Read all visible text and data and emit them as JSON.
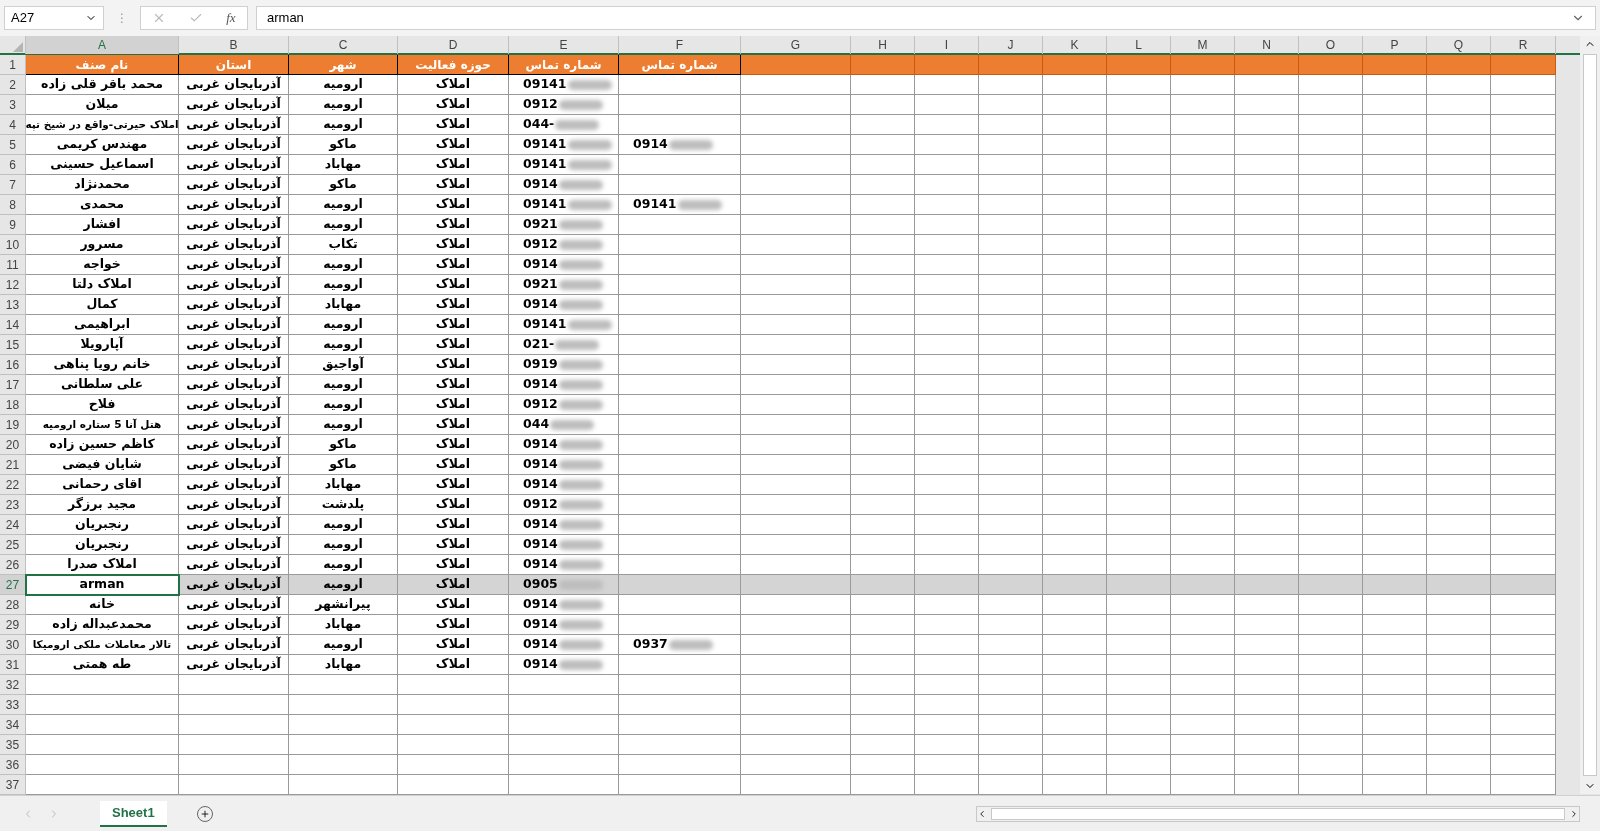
{
  "formula_bar": {
    "name_box": "A27",
    "separator": "⋮",
    "function_label": "fx",
    "value": "arman"
  },
  "columns": {
    "col_a": {
      "label": "A",
      "selected": true
    },
    "col_b": {
      "label": "B",
      "selected": false
    },
    "col_c": {
      "label": "C",
      "selected": false
    },
    "col_d": {
      "label": "D",
      "selected": false
    },
    "col_e": {
      "label": "E",
      "selected": false
    },
    "col_f": {
      "label": "F",
      "selected": false
    },
    "col_g": {
      "label": "G",
      "selected": false
    },
    "col_h": {
      "label": "H",
      "selected": false
    },
    "col_i": {
      "label": "I",
      "selected": false
    },
    "col_j": {
      "label": "J",
      "selected": false
    },
    "col_k": {
      "label": "K",
      "selected": false
    },
    "col_l": {
      "label": "L",
      "selected": false
    },
    "col_m": {
      "label": "M",
      "selected": false
    },
    "col_n": {
      "label": "N",
      "selected": false
    },
    "col_o": {
      "label": "O",
      "selected": false
    },
    "col_p": {
      "label": "P",
      "selected": false
    },
    "col_q": {
      "label": "Q",
      "selected": false
    },
    "col_r": {
      "label": "R",
      "selected": false
    }
  },
  "header_row": {
    "number": "1",
    "cells": {
      "col_a": "نام صنف",
      "col_b": "استان",
      "col_c": "شهر",
      "col_d": "حوزه فعالیت",
      "col_e": "شماره تماس",
      "col_f": "شماره تماس"
    }
  },
  "rows": [
    {
      "number": "2",
      "selected": false,
      "cells": {
        "col_a": "محمد باقر قلی زاده",
        "col_b": "آذربایجان غربی",
        "col_c": "ارومیه",
        "col_d": "املاک",
        "col_e": "09141"
      }
    },
    {
      "number": "3",
      "selected": false,
      "cells": {
        "col_a": "میلان",
        "col_b": "آذربایجان غربی",
        "col_c": "ارومیه",
        "col_d": "املاک",
        "col_e": "0912"
      }
    },
    {
      "number": "4",
      "selected": false,
      "cells": {
        "col_a": "املاک حیرتی-واقع در شیخ تپه",
        "col_b": "آذربایجان غربی",
        "col_c": "ارومیه",
        "col_d": "املاک",
        "col_e": "044-"
      }
    },
    {
      "number": "5",
      "selected": false,
      "cells": {
        "col_a": "مهندس کریمی",
        "col_b": "آذربایجان غربی",
        "col_c": "ماکو",
        "col_d": "املاک",
        "col_e": "09141",
        "col_f": "0914"
      }
    },
    {
      "number": "6",
      "selected": false,
      "cells": {
        "col_a": "اسماعیل حسینی",
        "col_b": "آذربایجان غربی",
        "col_c": "مهاباد",
        "col_d": "املاک",
        "col_e": "09141"
      }
    },
    {
      "number": "7",
      "selected": false,
      "cells": {
        "col_a": "محمدنژاد",
        "col_b": "آذربایجان غربی",
        "col_c": "ماکو",
        "col_d": "املاک",
        "col_e": "0914"
      }
    },
    {
      "number": "8",
      "selected": false,
      "cells": {
        "col_a": "محمدی",
        "col_b": "آذربایجان غربی",
        "col_c": "ارومیه",
        "col_d": "املاک",
        "col_e": "09141",
        "col_f": "09141"
      }
    },
    {
      "number": "9",
      "selected": false,
      "cells": {
        "col_a": "افشار",
        "col_b": "آذربایجان غربی",
        "col_c": "ارومیه",
        "col_d": "املاک",
        "col_e": "0921"
      }
    },
    {
      "number": "10",
      "selected": false,
      "cells": {
        "col_a": "مسرور",
        "col_b": "آذربایجان غربی",
        "col_c": "تکاب",
        "col_d": "املاک",
        "col_e": "0912"
      }
    },
    {
      "number": "11",
      "selected": false,
      "cells": {
        "col_a": "خواجه",
        "col_b": "آذربایجان غربی",
        "col_c": "ارومیه",
        "col_d": "املاک",
        "col_e": "0914"
      }
    },
    {
      "number": "12",
      "selected": false,
      "cells": {
        "col_a": "املاک دلتا",
        "col_b": "آذربایجان غربی",
        "col_c": "ارومیه",
        "col_d": "املاک",
        "col_e": "0921"
      }
    },
    {
      "number": "13",
      "selected": false,
      "cells": {
        "col_a": "کمال",
        "col_b": "آذربایجان غربی",
        "col_c": "مهاباد",
        "col_d": "املاک",
        "col_e": "0914"
      }
    },
    {
      "number": "14",
      "selected": false,
      "cells": {
        "col_a": "ابراهیمی",
        "col_b": "آذربایجان غربی",
        "col_c": "ارومیه",
        "col_d": "املاک",
        "col_e": "09141"
      }
    },
    {
      "number": "15",
      "selected": false,
      "cells": {
        "col_a": "آپارویلا",
        "col_b": "آذربایجان غربی",
        "col_c": "ارومیه",
        "col_d": "املاک",
        "col_e": "021-"
      }
    },
    {
      "number": "16",
      "selected": false,
      "cells": {
        "col_a": "خانم رویا پناهی",
        "col_b": "آذربایجان غربی",
        "col_c": "آواجیق",
        "col_d": "املاک",
        "col_e": "0919"
      }
    },
    {
      "number": "17",
      "selected": false,
      "cells": {
        "col_a": "علی سلطانی",
        "col_b": "آذربایجان غربی",
        "col_c": "ارومیه",
        "col_d": "املاک",
        "col_e": "0914"
      }
    },
    {
      "number": "18",
      "selected": false,
      "cells": {
        "col_a": "فلاح",
        "col_b": "آذربایجان غربی",
        "col_c": "ارومیه",
        "col_d": "املاک",
        "col_e": "0912"
      }
    },
    {
      "number": "19",
      "selected": false,
      "cells": {
        "col_a": "هتل آنا 5 ستاره ارومیه",
        "col_b": "آذربایجان غربی",
        "col_c": "ارومیه",
        "col_d": "املاک",
        "col_e": "044"
      }
    },
    {
      "number": "20",
      "selected": false,
      "cells": {
        "col_a": "کاظم حسین زاده",
        "col_b": "آذربایجان غربی",
        "col_c": "ماکو",
        "col_d": "املاک",
        "col_e": "0914"
      }
    },
    {
      "number": "21",
      "selected": false,
      "cells": {
        "col_a": "شایان فیضی",
        "col_b": "آذربایجان غربی",
        "col_c": "ماکو",
        "col_d": "املاک",
        "col_e": "0914"
      }
    },
    {
      "number": "22",
      "selected": false,
      "cells": {
        "col_a": "اقای رحمانی",
        "col_b": "آذربایجان غربی",
        "col_c": "مهاباد",
        "col_d": "املاک",
        "col_e": "0914"
      }
    },
    {
      "number": "23",
      "selected": false,
      "cells": {
        "col_a": "مجید برزگر",
        "col_b": "آذربایجان غربی",
        "col_c": "پلدشت",
        "col_d": "املاک",
        "col_e": "0912"
      }
    },
    {
      "number": "24",
      "selected": false,
      "cells": {
        "col_a": "رنجبریان",
        "col_b": "آذربایجان غربی",
        "col_c": "ارومیه",
        "col_d": "املاک",
        "col_e": "0914"
      }
    },
    {
      "number": "25",
      "selected": false,
      "cells": {
        "col_a": "رنجبریان",
        "col_b": "آذربایجان غربی",
        "col_c": "ارومیه",
        "col_d": "املاک",
        "col_e": "0914"
      }
    },
    {
      "number": "26",
      "selected": false,
      "cells": {
        "col_a": "املاک صدرا",
        "col_b": "آذربایجان غربی",
        "col_c": "ارومیه",
        "col_d": "املاک",
        "col_e": "0914"
      }
    },
    {
      "number": "27",
      "selected": true,
      "cells": {
        "col_a": "arman",
        "col_b": "آذربایجان غربی",
        "col_c": "ارومیه",
        "col_d": "املاک",
        "col_e": "0905"
      }
    },
    {
      "number": "28",
      "selected": false,
      "cells": {
        "col_a": "خانه",
        "col_b": "آذربایجان غربی",
        "col_c": "پیرانشهر",
        "col_d": "املاک",
        "col_e": "0914"
      }
    },
    {
      "number": "29",
      "selected": false,
      "cells": {
        "col_a": "محمدعبداله زاده",
        "col_b": "آذربایجان غربی",
        "col_c": "مهاباد",
        "col_d": "املاک",
        "col_e": "0914"
      }
    },
    {
      "number": "30",
      "selected": false,
      "cells": {
        "col_a": "تالار معاملات ملکی ارومیکا",
        "col_b": "آذربایجان غربی",
        "col_c": "ارومیه",
        "col_d": "املاک",
        "col_e": "0914",
        "col_f": "0937"
      }
    },
    {
      "number": "31",
      "selected": false,
      "cells": {
        "col_a": "طه همتی",
        "col_b": "آذربایجان غربی",
        "col_c": "مهاباد",
        "col_d": "املاک",
        "col_e": "0914"
      }
    }
  ],
  "empty_rows": [
    "32",
    "33",
    "34",
    "35",
    "36",
    "37"
  ],
  "sheet_tabs": [
    {
      "label": "Sheet1",
      "selected": true
    }
  ]
}
